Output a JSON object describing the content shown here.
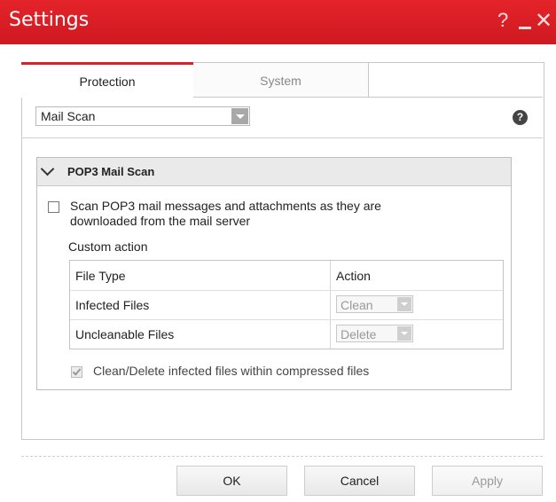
{
  "window": {
    "title": "Settings",
    "help_glyph": "?",
    "close_glyph": "✕"
  },
  "tabs": [
    {
      "label": "Protection",
      "active": true
    },
    {
      "label": "System",
      "active": false
    }
  ],
  "selector": {
    "value": "Mail Scan",
    "help_glyph": "?"
  },
  "section": {
    "title": "POP3 Mail Scan",
    "scan_option": {
      "label": "Scan POP3 mail messages and attachments as they are downloaded from the mail server",
      "checked": false
    },
    "custom_action_label": "Custom action",
    "table": {
      "headers": [
        "File Type",
        "Action"
      ],
      "rows": [
        {
          "file_type": "Infected Files",
          "action": "Clean"
        },
        {
          "file_type": "Uncleanable Files",
          "action": "Delete"
        }
      ]
    },
    "compressed_option": {
      "label": "Clean/Delete infected files within compressed files",
      "checked": true,
      "disabled": true
    }
  },
  "buttons": {
    "ok": "OK",
    "cancel": "Cancel",
    "apply": "Apply"
  },
  "colors": {
    "accent": "#d8222a",
    "titlebar": "#e4232a"
  }
}
